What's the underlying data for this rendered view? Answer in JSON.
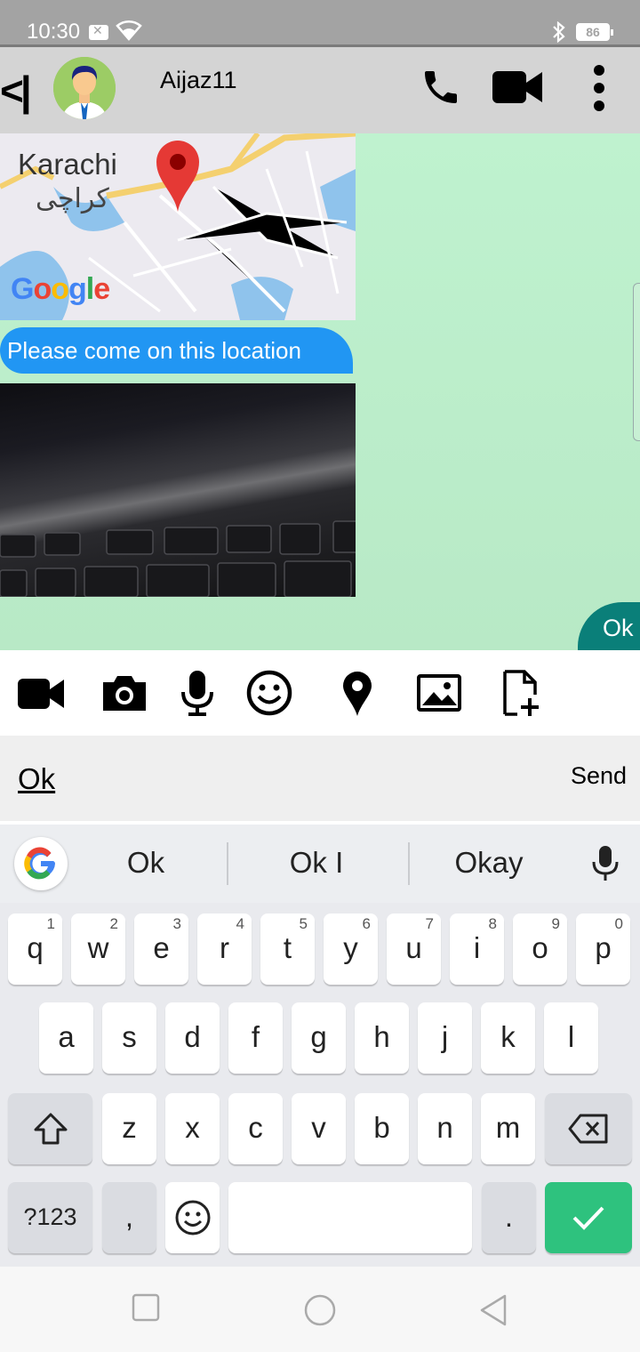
{
  "status_bar": {
    "time": "10:30",
    "battery": "86"
  },
  "header": {
    "back_label": "<|",
    "contact_name": "Aijaz11",
    "icons": [
      "phone-icon",
      "video-call-icon",
      "more-vert-icon"
    ]
  },
  "messages": {
    "map": {
      "city": "Karachi",
      "city_urdu": "کراچی",
      "logo": "Google"
    },
    "incoming_text": "Please come on this location",
    "outgoing_text": "Ok"
  },
  "attachments": [
    "video-icon",
    "camera-icon",
    "mic-icon",
    "emoji-icon",
    "location-icon",
    "image-icon",
    "file-add-icon"
  ],
  "composer": {
    "value": "Ok",
    "send_label": "Send"
  },
  "keyboard": {
    "suggestions": [
      "Ok",
      "Ok I",
      "Okay"
    ],
    "row1": [
      [
        "q",
        "1"
      ],
      [
        "w",
        "2"
      ],
      [
        "e",
        "3"
      ],
      [
        "r",
        "4"
      ],
      [
        "t",
        "5"
      ],
      [
        "y",
        "6"
      ],
      [
        "u",
        "7"
      ],
      [
        "i",
        "8"
      ],
      [
        "o",
        "9"
      ],
      [
        "p",
        "0"
      ]
    ],
    "row2": [
      "a",
      "s",
      "d",
      "f",
      "g",
      "h",
      "j",
      "k",
      "l"
    ],
    "row3": [
      "z",
      "x",
      "c",
      "v",
      "b",
      "n",
      "m"
    ],
    "row4": {
      "symbols": "?123",
      "comma": ",",
      "period": "."
    }
  },
  "colors": {
    "incoming_bubble": "#2196f3",
    "outgoing_bubble": "#0a7f79",
    "enter_key": "#2ec27e",
    "chat_bg": "#bff2cf"
  }
}
